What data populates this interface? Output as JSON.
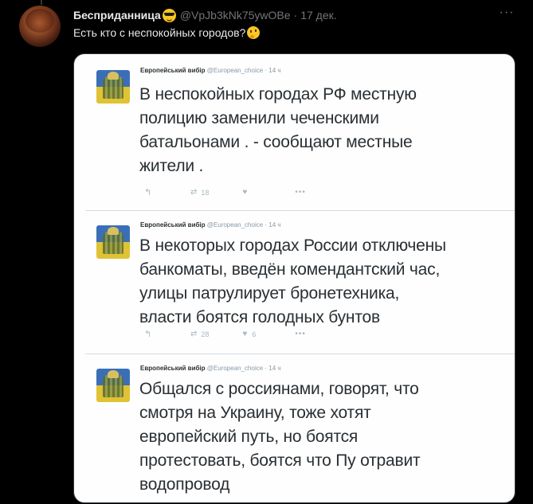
{
  "tweet": {
    "author_name": "Бесприданница",
    "author_emoji": "smiling-face-with-sunglasses-icon",
    "handle": "@VpJb3kNk75ywOBe",
    "separator": "·",
    "date": "17 дек.",
    "text": "Есть кто с неспокойных городов?",
    "text_emoji": "thinking-face-icon",
    "more_glyph": "···"
  },
  "media": {
    "embeds": [
      {
        "name": "Европейський вибір",
        "handle": "@European_choice",
        "time": "· 14 ч",
        "lines": [
          "В неспокойных городах РФ местную",
          "полицию заменили чеченскими",
          "батальонами . - сообщают местные",
          "жители ."
        ],
        "actions": {
          "retweets": "18",
          "likes": "",
          "more": "•••"
        }
      },
      {
        "name": "Европейський вибір",
        "handle": "@European_choice",
        "time": "· 14 ч",
        "lines": [
          "В некоторых городах России отключены",
          "банкоматы, введён комендантский час,",
          "улицы патрулирует бронетехника,",
          "власти боятся голодных бунтов"
        ],
        "actions": {
          "retweets": "28",
          "likes": "6",
          "more": "•••"
        }
      },
      {
        "name": "Европейський вибір",
        "handle": "@European_choice",
        "time": "· 14 ч",
        "lines": [
          "Общался с россиянами, говорят, что",
          "смотря на Украину, тоже хотят",
          "европейский путь, но боятся",
          "протестовать, боятся что Пу отравит",
          "водопровод"
        ]
      }
    ]
  },
  "colors": {
    "background": "#000000",
    "text_primary": "#e7e9ea",
    "text_secondary": "#71767b",
    "embed_text": "#292f33",
    "embed_meta": "#8899a6"
  }
}
